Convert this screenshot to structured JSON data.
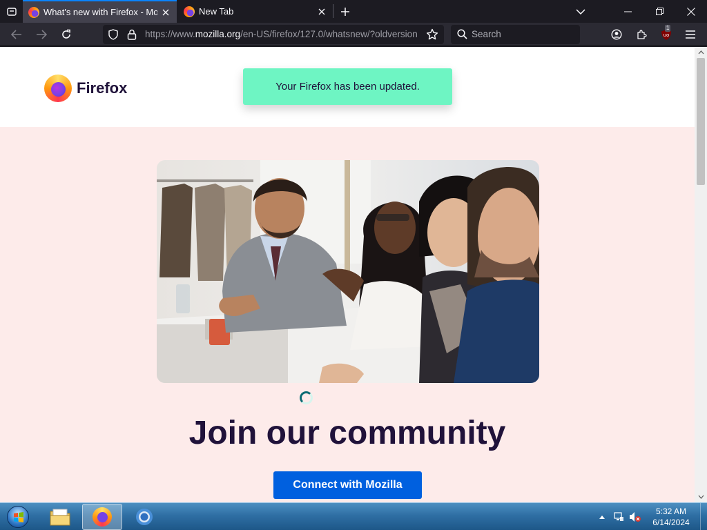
{
  "browser": {
    "tabs": [
      {
        "title": "What's new with Firefox - More p",
        "active": true
      },
      {
        "title": "New Tab",
        "active": false
      }
    ],
    "url_prefix": "https://www.",
    "url_domain": "mozilla.org",
    "url_path": "/en-US/firefox/127.0/whatsnew/?oldversion",
    "search_placeholder": "Search",
    "extension_badge": "1"
  },
  "page": {
    "logo_text": "Firefox",
    "toast": "Your Firefox has been updated.",
    "heading": "Join our community",
    "cta": "Connect with Mozilla"
  },
  "taskbar": {
    "time": "5:32 AM",
    "date": "6/14/2024"
  },
  "colors": {
    "accent": "#0060df",
    "toast": "#6ef5c3",
    "hero_bg": "#fdebea",
    "heading": "#20123a"
  }
}
